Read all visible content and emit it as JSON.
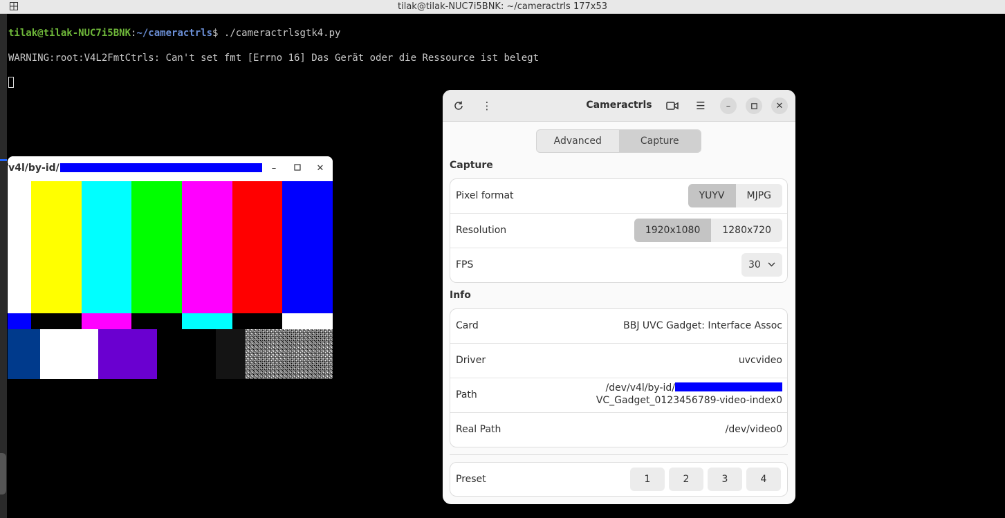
{
  "terminal": {
    "title": "tilak@tilak-NUC7i5BNK: ~/cameractrls 177x53",
    "prompt_user": "tilak@tilak-NUC7i5BNK",
    "prompt_sep": ":",
    "prompt_path": "~/cameractrls",
    "prompt_end": "$",
    "command": " ./cameractrlsgtk4.py",
    "warning": "WARNING:root:V4L2FmtCtrls: Can't set fmt [Errno 16] Das Gerät oder die Ressource ist belegt"
  },
  "preview": {
    "title": "/v4l/by-id/"
  },
  "cameractrls": {
    "title": "Cameractrls",
    "tabs": [
      {
        "label": "Advanced",
        "active": false
      },
      {
        "label": "Capture",
        "active": true
      }
    ],
    "capture": {
      "heading": "Capture",
      "pixel_format": {
        "label": "Pixel format",
        "options": [
          "YUYV",
          "MJPG"
        ],
        "selected": "YUYV"
      },
      "resolution": {
        "label": "Resolution",
        "options": [
          "1920x1080",
          "1280x720"
        ],
        "selected": "1920x1080"
      },
      "fps": {
        "label": "FPS",
        "value": "30"
      }
    },
    "info": {
      "heading": "Info",
      "card": {
        "label": "Card",
        "value": "BBJ UVC Gadget: Interface Assoc"
      },
      "driver": {
        "label": "Driver",
        "value": "uvcvideo"
      },
      "path": {
        "label": "Path",
        "value_prefix": "/dev/v4l/by-id/",
        "value_line2": "VC_Gadget_0123456789-video-index0"
      },
      "real_path": {
        "label": "Real Path",
        "value": "/dev/video0"
      }
    },
    "preset": {
      "label": "Preset",
      "buttons": [
        "1",
        "2",
        "3",
        "4"
      ]
    }
  },
  "colors": {
    "terminal_bg": "#000000",
    "prompt_user": "#6fb83a",
    "prompt_path": "#6b8fd6",
    "redaction": "#0000ff"
  }
}
